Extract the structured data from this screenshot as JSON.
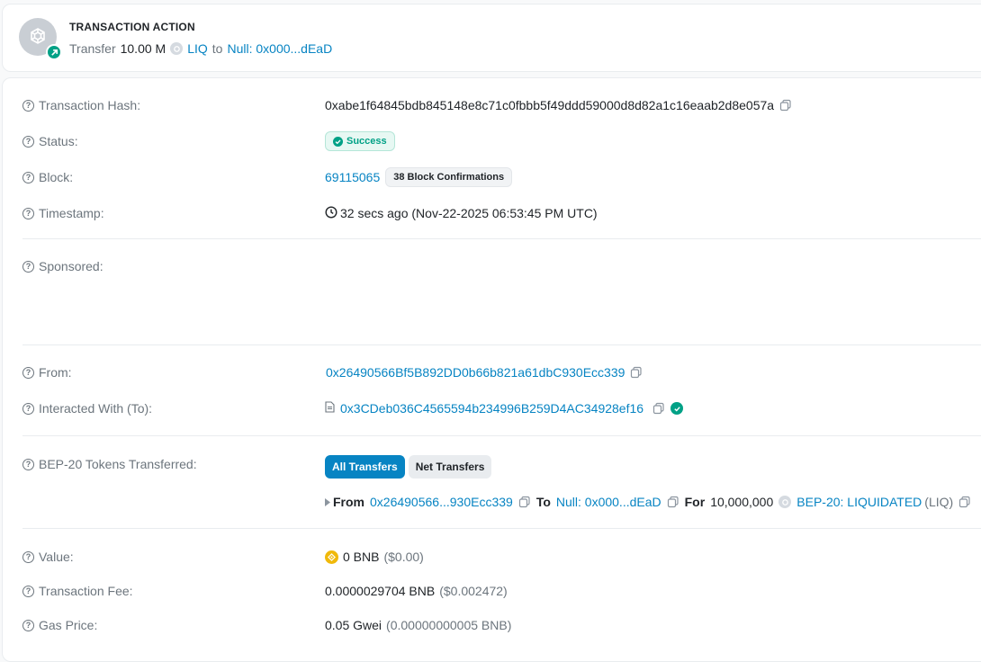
{
  "action": {
    "title": "TRANSACTION ACTION",
    "verb": "Transfer",
    "amount": "10.00 M",
    "token": "LIQ",
    "to_word": "to",
    "recipient": "Null: 0x000...dEaD",
    "logo_icon": "bnb-chain-logo-icon",
    "badge_icon": "arrow-up-right-icon"
  },
  "details": {
    "hash": {
      "label": "Transaction Hash:",
      "value": "0xabe1f64845bdb845148e8c71c0fbbb5f49ddd59000d8d82a1c16eaab2d8e057a"
    },
    "status": {
      "label": "Status:",
      "value": "Success"
    },
    "block": {
      "label": "Block:",
      "value": "69115065",
      "confirmations": "38 Block Confirmations"
    },
    "timestamp": {
      "label": "Timestamp:",
      "value": "32 secs ago (Nov-22-2025 06:53:45 PM UTC)"
    },
    "sponsored": {
      "label": "Sponsored:"
    },
    "from": {
      "label": "From:",
      "value": "0x26490566Bf5B892DD0b66b821a61dbC930Ecc339"
    },
    "to": {
      "label": "Interacted With (To):",
      "value": "0x3CDeb036C4565594b234996B259D4AC34928ef16"
    },
    "tokens": {
      "label": "BEP-20 Tokens Transferred:",
      "tab_all": "All Transfers",
      "tab_net": "Net Transfers",
      "transfer": {
        "from_label": "From",
        "from": "0x26490566...930Ecc339",
        "to_label": "To",
        "to": "Null: 0x000...dEaD",
        "for_label": "For",
        "amount": "10,000,000",
        "token_name": "BEP-20: LIQUIDATED",
        "token_symbol": "(LIQ)"
      }
    },
    "value": {
      "label": "Value:",
      "amount": "0 BNB",
      "usd": "($0.00)"
    },
    "fee": {
      "label": "Transaction Fee:",
      "amount": "0.0000029704 BNB",
      "usd": "($0.002472)"
    },
    "gas": {
      "label": "Gas Price:",
      "amount": "0.05 Gwei",
      "bnb": "(0.00000000005 BNB)"
    }
  },
  "colors": {
    "link": "#0784c3",
    "success": "#00a186",
    "bnb": "#f0b90b"
  }
}
